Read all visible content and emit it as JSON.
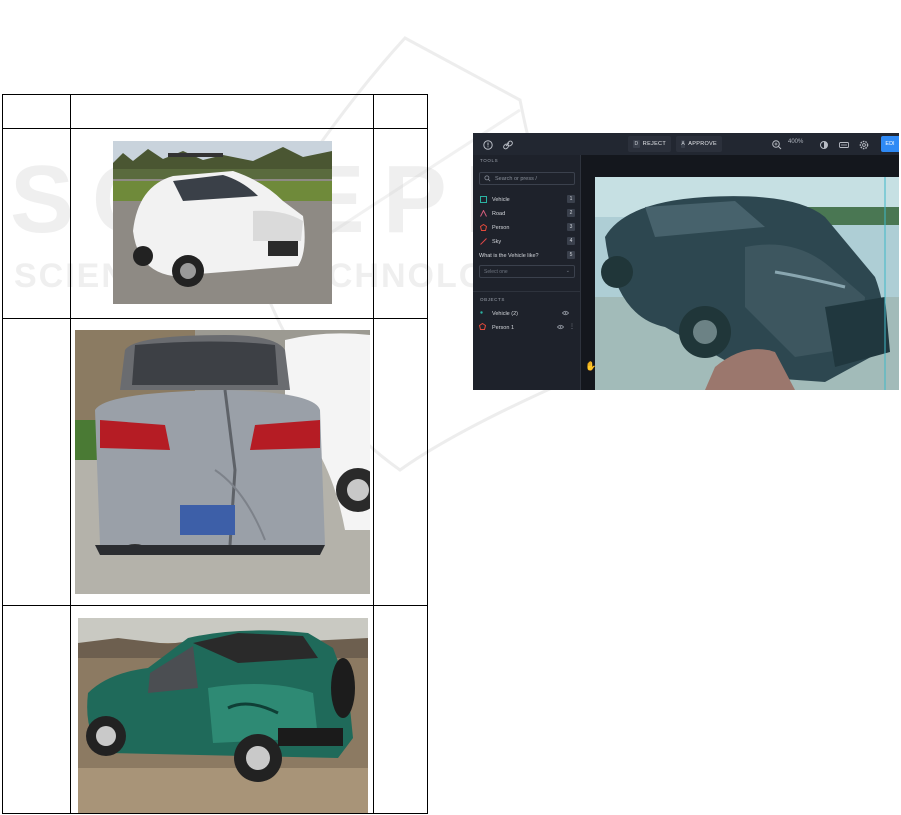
{
  "watermark": {
    "line1": "SCITEPRESS",
    "line2": "SCIENCE AND TECHNOLOGY PUBLICATIONS"
  },
  "app": {
    "topbar": {
      "reject_key": "D",
      "reject_label": "REJECT",
      "approve_key": "A",
      "approve_label": "APPROVE",
      "zoom": "400%",
      "edit_label": "EDI"
    },
    "sidebar": {
      "tools_title": "TOOLS",
      "search_placeholder": "Search or press /",
      "tools": [
        {
          "label": "Vehicle",
          "key": "1",
          "color": "#2bb3a3",
          "icon": "square-icon"
        },
        {
          "label": "Road",
          "key": "2",
          "color": "#d05c7a",
          "icon": "polyline-icon"
        },
        {
          "label": "Person",
          "key": "3",
          "color": "#e24a3b",
          "icon": "polygon-icon"
        },
        {
          "label": "Sky",
          "key": "4",
          "color": "#e04848",
          "icon": "line-icon"
        }
      ],
      "question": {
        "label": "What is the Vehicle like?",
        "key": "5"
      },
      "select_placeholder": "Select one",
      "objects_title": "OBJECTS",
      "objects": [
        {
          "label": "Vehicle (2)",
          "color": "#2bb3a3"
        },
        {
          "label": "Person 1",
          "color": "#e24a3b"
        }
      ]
    }
  }
}
